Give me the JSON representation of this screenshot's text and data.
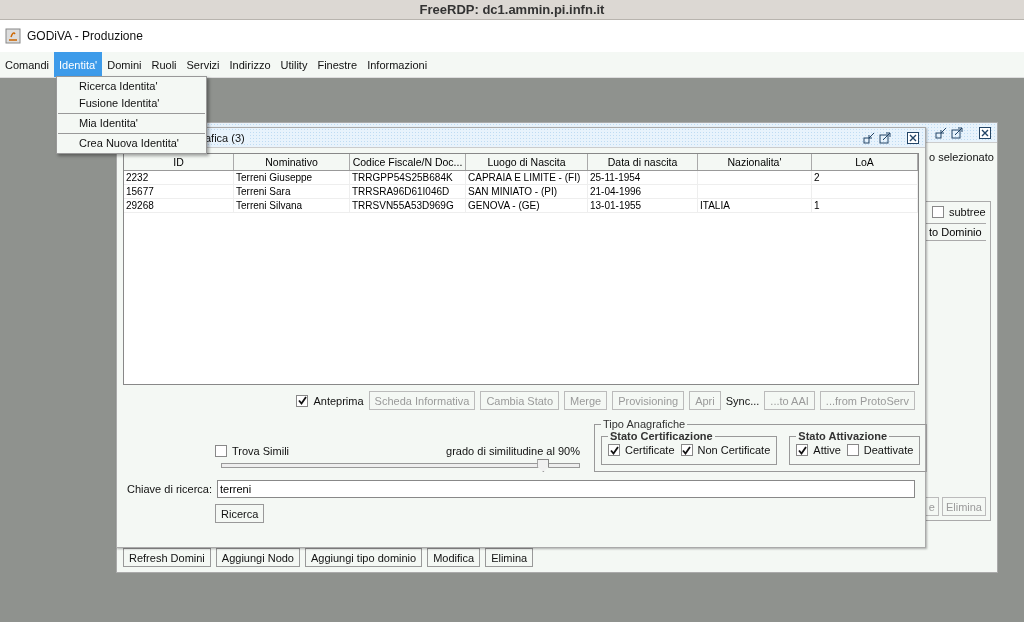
{
  "remote_title": "FreeRDP: dc1.ammin.pi.infn.it",
  "window": {
    "title": "GODiVA - Produzione"
  },
  "menu_bar": [
    {
      "label": "Comandi",
      "selected": false
    },
    {
      "label": "Identita'",
      "selected": true
    },
    {
      "label": "Domini",
      "selected": false
    },
    {
      "label": "Ruoli",
      "selected": false
    },
    {
      "label": "Servizi",
      "selected": false
    },
    {
      "label": "Indirizzo",
      "selected": false
    },
    {
      "label": "Utility",
      "selected": false
    },
    {
      "label": "Finestre",
      "selected": false
    },
    {
      "label": "Informazioni",
      "selected": false
    }
  ],
  "open_menu": [
    {
      "kind": "item",
      "label": "Ricerca Identita'"
    },
    {
      "kind": "item",
      "label": "Fusione Identita'"
    },
    {
      "kind": "separator"
    },
    {
      "kind": "item",
      "label": "Mia Identita'"
    },
    {
      "kind": "separator"
    },
    {
      "kind": "item",
      "label": "Crea Nuova Identita'"
    }
  ],
  "back_frame": {
    "text_1": "o selezionato",
    "subtree": {
      "label": "subtree",
      "checked": false
    },
    "column_1": "to Dominio",
    "side_buttons": [
      {
        "label": "e",
        "disabled": true
      },
      {
        "label": "Elimina",
        "disabled": true
      }
    ],
    "bottom_buttons": [
      "Refresh Domini",
      "Aggiungi Nodo",
      "Aggiungi tipo dominio",
      "Modifica",
      "Elimina"
    ]
  },
  "search_frame": {
    "title": "afica (3)",
    "table": {
      "columns": [
        "ID",
        "Nominativo",
        "Codice Fiscale/N Doc...",
        "Luogo di Nascita",
        "Data di nascita",
        "Nazionalita'",
        "LoA"
      ],
      "rows": [
        [
          "2232",
          "Terreni Giuseppe",
          "TRRGPP54S25B684K",
          "CAPRAIA E LIMITE - (FI)",
          "25-11-1954",
          "",
          "2"
        ],
        [
          "15677",
          "Terreni Sara",
          "TRRSRA96D61I046D",
          "SAN MINIATO - (PI)",
          "21-04-1996",
          "",
          ""
        ],
        [
          "29268",
          "Terreni Silvana",
          "TRRSVN55A53D969G",
          "GENOVA - (GE)",
          "13-01-1955",
          "ITALIA",
          "1"
        ]
      ]
    },
    "preview": {
      "label": "Anteprima",
      "checked": true
    },
    "actions": [
      {
        "kind": "button",
        "label": "Scheda Informativa",
        "disabled": true
      },
      {
        "kind": "button",
        "label": "Cambia Stato",
        "disabled": true
      },
      {
        "kind": "button",
        "label": "Merge",
        "disabled": true
      },
      {
        "kind": "button",
        "label": "Provisioning",
        "disabled": true
      },
      {
        "kind": "button",
        "label": "Apri",
        "disabled": true
      },
      {
        "kind": "text",
        "label": "Sync..."
      },
      {
        "kind": "button",
        "label": "...to AAI",
        "disabled": true
      },
      {
        "kind": "button",
        "label": "...from ProtoServ",
        "disabled": true
      }
    ],
    "find_similar": {
      "label": "Trova Simili",
      "checked": false
    },
    "similarity": {
      "label": "grado di similitudine al 90%",
      "level": 0.9
    },
    "types": {
      "title": "Tipo Anagrafiche",
      "groups": [
        {
          "title": "Stato Certificazione",
          "options": [
            {
              "label": "Certificate",
              "checked": true
            },
            {
              "label": "Non Certificate",
              "checked": true
            }
          ]
        },
        {
          "title": "Stato Attivazione",
          "options": [
            {
              "label": "Attive",
              "checked": true
            },
            {
              "label": "Deattivate",
              "checked": false
            }
          ]
        }
      ]
    },
    "search_key": {
      "label": "Chiave di ricerca:",
      "value": "terreni"
    },
    "search_button": "Ricerca"
  }
}
